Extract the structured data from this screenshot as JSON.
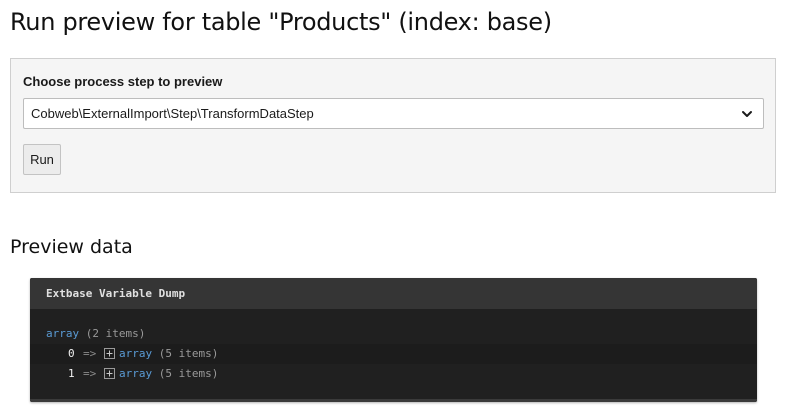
{
  "page": {
    "title": "Run preview for table \"Products\" (index: base)"
  },
  "step_panel": {
    "label": "Choose process step to preview",
    "selected_value": "Cobweb\\ExternalImport\\Step\\TransformDataStep",
    "run_label": "Run"
  },
  "preview": {
    "section_title": "Preview data",
    "dump": {
      "header": "Extbase Variable Dump",
      "root_type": "array",
      "root_count": "(2 items)",
      "arrow": "=>",
      "rows": [
        {
          "key": "0",
          "type": "array",
          "count": "(5 items)"
        },
        {
          "key": "1",
          "type": "array",
          "count": "(5 items)"
        }
      ]
    }
  },
  "colors": {
    "dump_background": "#202020",
    "dump_header": "#353535",
    "type_accent": "#5a9bd5",
    "panel_background": "#f5f5f5"
  },
  "icons": {
    "select_indicator": "chevron-down-icon",
    "expand_toggle": "plus-box-icon"
  }
}
